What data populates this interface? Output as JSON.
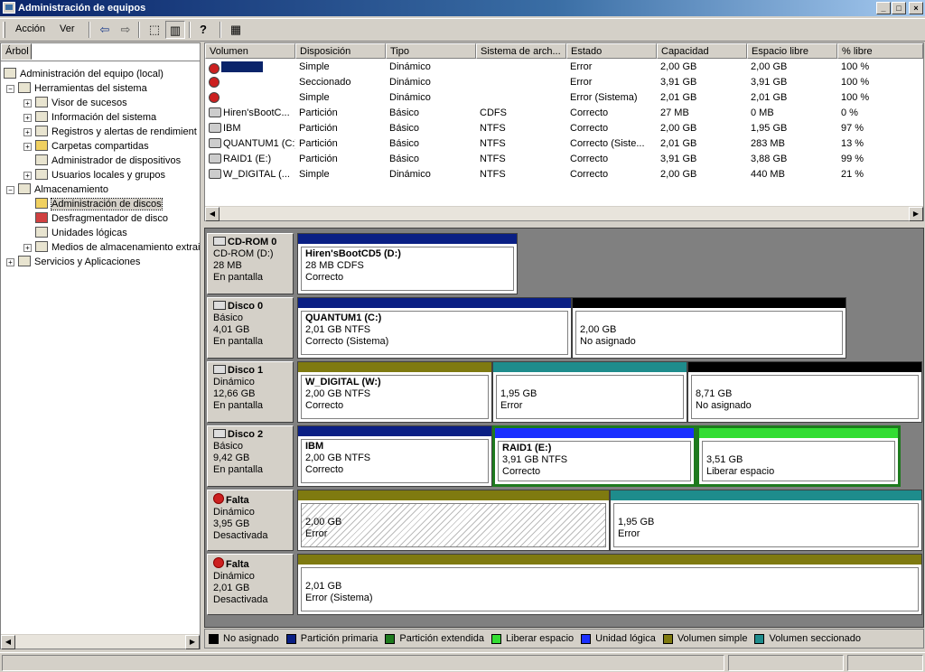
{
  "window": {
    "title": "Administración de equipos",
    "btn_min": "_",
    "btn_max": "□",
    "btn_close": "×"
  },
  "menu": {
    "accion": "Acción",
    "ver": "Ver"
  },
  "toolbar": {
    "back": "⇦",
    "forward": "⇨",
    "up": "⬚",
    "tree": "▥",
    "help": "?",
    "props": "▦"
  },
  "tree": {
    "tab": "Árbol",
    "items": [
      {
        "label": "Administración del equipo (local)"
      },
      {
        "label": "Herramientas del sistema"
      },
      {
        "label": "Visor de sucesos"
      },
      {
        "label": "Información del sistema"
      },
      {
        "label": "Registros y alertas de rendimient"
      },
      {
        "label": "Carpetas compartidas"
      },
      {
        "label": "Administrador de dispositivos"
      },
      {
        "label": "Usuarios locales y grupos"
      },
      {
        "label": "Almacenamiento"
      },
      {
        "label": "Administración de discos"
      },
      {
        "label": "Desfragmentador de disco"
      },
      {
        "label": "Unidades lógicas"
      },
      {
        "label": "Medios de almacenamiento extrai"
      },
      {
        "label": "Servicios y Aplicaciones"
      }
    ]
  },
  "volumes": {
    "columns": [
      "Volumen",
      "Disposición",
      "Tipo",
      "Sistema de arch...",
      "Estado",
      "Capacidad",
      "Espacio libre",
      "% libre"
    ],
    "rows": [
      [
        "",
        "Simple",
        "Dinámico",
        "",
        "Error",
        "2,00 GB",
        "2,00 GB",
        "100 %"
      ],
      [
        "",
        "Seccionado",
        "Dinámico",
        "",
        "Error",
        "3,91 GB",
        "3,91 GB",
        "100 %"
      ],
      [
        "",
        "Simple",
        "Dinámico",
        "",
        "Error (Sistema)",
        "2,01 GB",
        "2,01 GB",
        "100 %"
      ],
      [
        "Hiren'sBootC...",
        "Partición",
        "Básico",
        "CDFS",
        "Correcto",
        "27 MB",
        "0 MB",
        "0 %"
      ],
      [
        "IBM",
        "Partición",
        "Básico",
        "NTFS",
        "Correcto",
        "2,00 GB",
        "1,95 GB",
        "97 %"
      ],
      [
        "QUANTUM1 (C:)",
        "Partición",
        "Básico",
        "NTFS",
        "Correcto (Siste...",
        "2,01 GB",
        "283 MB",
        "13 %"
      ],
      [
        "RAID1 (E:)",
        "Partición",
        "Básico",
        "NTFS",
        "Correcto",
        "3,91 GB",
        "3,88 GB",
        "99 %"
      ],
      [
        "W_DIGITAL (...",
        "Simple",
        "Dinámico",
        "NTFS",
        "Correcto",
        "2,00 GB",
        "440 MB",
        "21 %"
      ]
    ]
  },
  "disks": [
    {
      "name": "CD-ROM 0",
      "l1": "CD-ROM (D:)",
      "l2": "28 MB",
      "l3": "En pantalla",
      "parts": [
        {
          "title": "Hiren'sBootCD5  (D:)",
          "l1": "28 MB CDFS",
          "l2": "Correcto"
        }
      ]
    },
    {
      "name": "Disco 0",
      "l1": "Básico",
      "l2": "4,01 GB",
      "l3": "En pantalla",
      "parts": [
        {
          "title": "QUANTUM1  (C:)",
          "l1": "2,01 GB NTFS",
          "l2": "Correcto (Sistema)"
        },
        {
          "title": "",
          "l1": "2,00 GB",
          "l2": "No asignado"
        }
      ]
    },
    {
      "name": "Disco 1",
      "l1": "Dinámico",
      "l2": "12,66 GB",
      "l3": "En pantalla",
      "parts": [
        {
          "title": "W_DIGITAL  (W:)",
          "l1": "2,00 GB NTFS",
          "l2": "Correcto"
        },
        {
          "title": "",
          "l1": "1,95 GB",
          "l2": "Error"
        },
        {
          "title": "",
          "l1": "8,71 GB",
          "l2": "No asignado"
        }
      ]
    },
    {
      "name": "Disco 2",
      "l1": "Básico",
      "l2": "9,42 GB",
      "l3": "En pantalla",
      "parts": [
        {
          "title": "IBM",
          "l1": "2,00 GB NTFS",
          "l2": "Correcto"
        },
        {
          "title": "RAID1  (E:)",
          "l1": "3,91 GB NTFS",
          "l2": "Correcto"
        },
        {
          "title": "",
          "l1": "3,51 GB",
          "l2": "Liberar espacio"
        }
      ]
    },
    {
      "name": "Falta",
      "l1": "Dinámico",
      "l2": "3,95 GB",
      "l3": "Desactivada",
      "parts": [
        {
          "title": "",
          "l1": "2,00 GB",
          "l2": "Error"
        },
        {
          "title": "",
          "l1": "1,95 GB",
          "l2": "Error"
        }
      ]
    },
    {
      "name": "Falta",
      "l1": "Dinámico",
      "l2": "2,01 GB",
      "l3": "Desactivada",
      "parts": [
        {
          "title": "",
          "l1": "2,01 GB",
          "l2": "Error (Sistema)"
        }
      ]
    }
  ],
  "legend": [
    {
      "label": "No asignado",
      "color": "#000000"
    },
    {
      "label": "Partición primaria",
      "color": "#0a1f84"
    },
    {
      "label": "Partición extendida",
      "color": "#1e7a1e"
    },
    {
      "label": "Liberar espacio",
      "color": "#33dd33"
    },
    {
      "label": "Unidad lógica",
      "color": "#1a2fff"
    },
    {
      "label": "Volumen simple",
      "color": "#7f7a10"
    },
    {
      "label": "Volumen seccionado",
      "color": "#1e8c8c"
    }
  ],
  "colors": {
    "no_asignado": "#000000",
    "primaria": "#0a1f84",
    "extendida": "#1e7a1e",
    "libre": "#33dd33",
    "logica": "#1a2fff",
    "simple": "#7f7a10",
    "seccionado": "#1e8c8c"
  }
}
